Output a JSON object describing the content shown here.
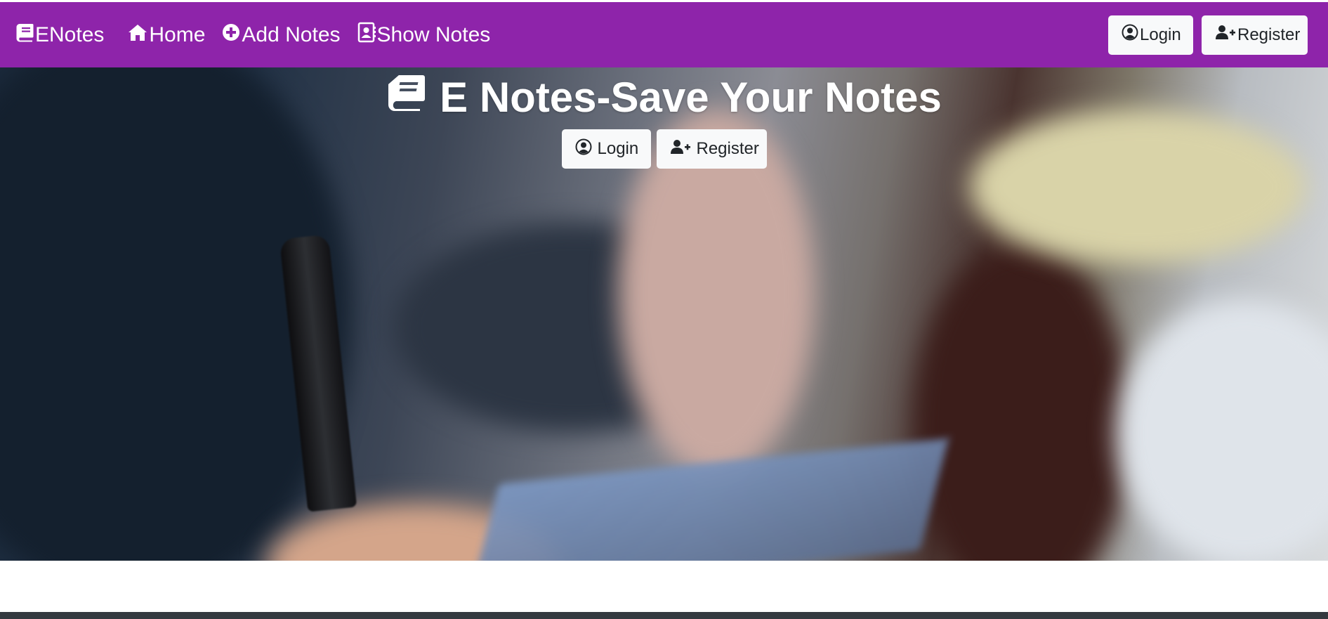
{
  "navbar": {
    "brand": "ENotes",
    "links": [
      {
        "label": "Home",
        "icon": "home-icon"
      },
      {
        "label": "Add Notes",
        "icon": "plus-circle-icon"
      },
      {
        "label": "Show Notes",
        "icon": "address-book-icon"
      }
    ],
    "login_label": "Login",
    "register_label": "Register",
    "background_color": "#8e24aa"
  },
  "hero": {
    "title": "E Notes-Save Your Notes",
    "login_label": "Login",
    "register_label": "Register"
  },
  "colors": {
    "brand": "#8e24aa",
    "button_bg": "#f8f9fa",
    "footer": "#343a40"
  }
}
